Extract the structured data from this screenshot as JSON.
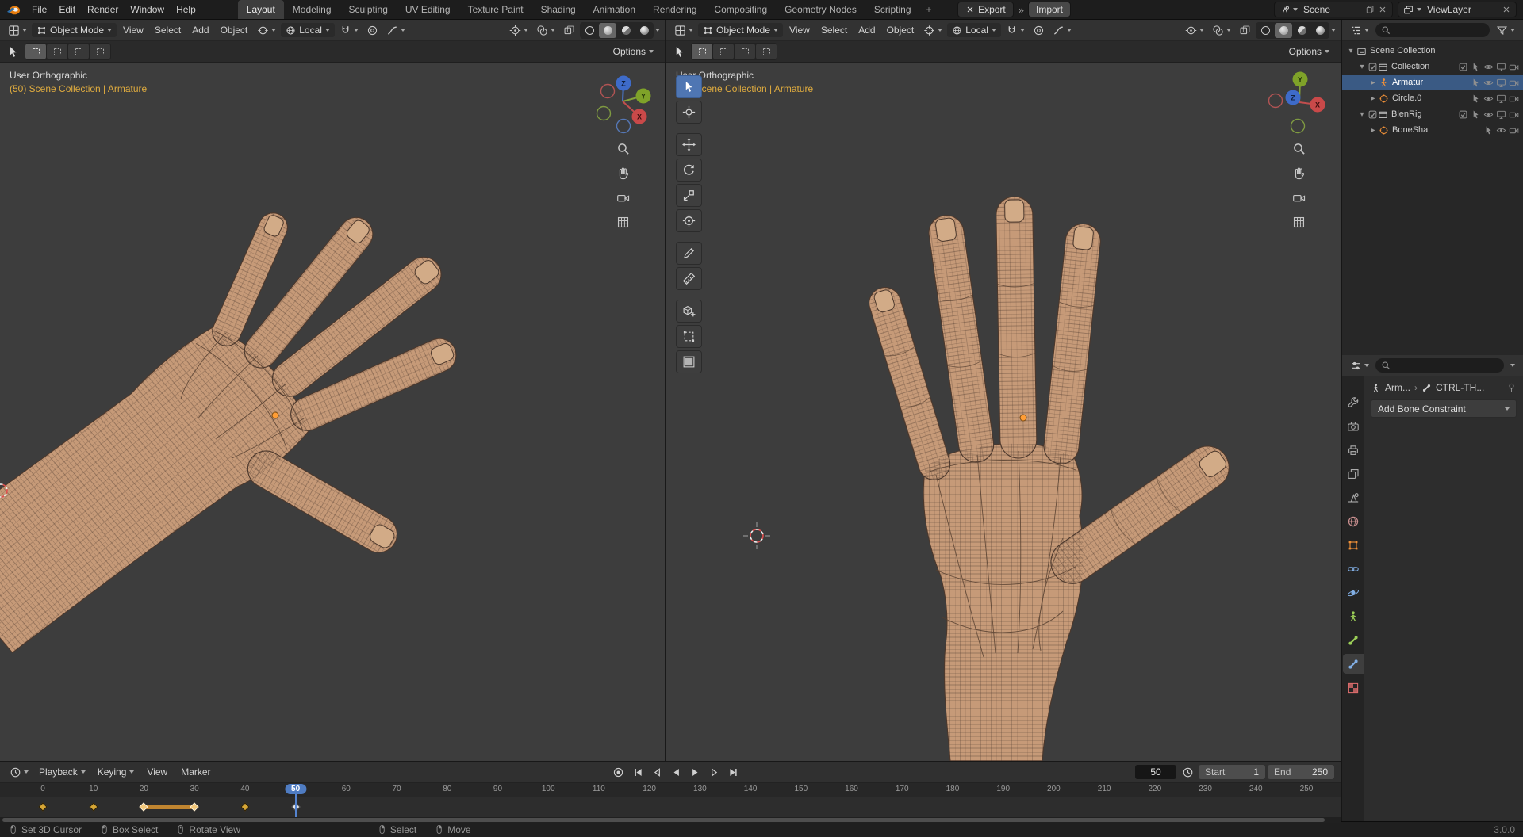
{
  "topbar": {
    "menus": [
      "File",
      "Edit",
      "Render",
      "Window",
      "Help"
    ],
    "workspaces": [
      "Layout",
      "Modeling",
      "Sculpting",
      "UV Editing",
      "Texture Paint",
      "Shading",
      "Animation",
      "Rendering",
      "Compositing",
      "Geometry Nodes",
      "Scripting"
    ],
    "active_workspace": "Layout",
    "add_tab_label": "+",
    "export_label": "Export",
    "import_label": "Import",
    "scene_name": "Scene",
    "viewlayer_name": "ViewLayer"
  },
  "viewport": {
    "mode_label": "Object Mode",
    "menus": [
      "View",
      "Select",
      "Add",
      "Object"
    ],
    "orientation_label": "Local",
    "options_label": "Options",
    "view_name": "User Orthographic",
    "context_line": "(50) Scene Collection | Armature",
    "gizmo_axes": [
      "X",
      "Y",
      "Z"
    ],
    "header_toggles": [
      "gizmos",
      "overlays",
      "xray"
    ],
    "shading_modes": [
      "wireframe",
      "solid",
      "material",
      "rendered"
    ],
    "active_shading": "solid"
  },
  "toolbar": {
    "tools": [
      {
        "icon": "select-box",
        "active": true
      },
      {
        "icon": "cursor",
        "gap": true
      },
      {
        "icon": "move"
      },
      {
        "icon": "rotate"
      },
      {
        "icon": "scale"
      },
      {
        "icon": "transform",
        "gap": true
      },
      {
        "icon": "annotate"
      },
      {
        "icon": "measure",
        "gap": true
      },
      {
        "icon": "add-cube"
      },
      {
        "icon": "scale-cage"
      },
      {
        "icon": "mesh-tool"
      }
    ]
  },
  "outliner": {
    "rows": [
      {
        "label": "Scene Collection",
        "icon": "scene-collection",
        "icon_color": "#c9c9c9",
        "indent": 0,
        "expand": "open",
        "controls": []
      },
      {
        "label": "Collection",
        "icon": "collection",
        "icon_color": "#c9c9c9",
        "indent": 1,
        "expand": "open",
        "checkbox": true,
        "controls": [
          "checkbox",
          "pointer",
          "eye",
          "monitor",
          "camera"
        ]
      },
      {
        "label": "Armatur",
        "icon": "armature",
        "icon_color": "#ef9038",
        "indent": 2,
        "expand": "closed",
        "selected": true,
        "controls": [
          "pointer",
          "eye",
          "monitor",
          "camera"
        ]
      },
      {
        "label": "Circle.0",
        "icon": "mesh-circle",
        "icon_color": "#ef9038",
        "indent": 2,
        "expand": "closed",
        "controls": [
          "pointer",
          "eye",
          "monitor",
          "camera"
        ]
      },
      {
        "label": "BlenRig",
        "icon": "collection",
        "icon_color": "#c9c9c9",
        "indent": 1,
        "expand": "open",
        "checkbox": true,
        "controls": [
          "checkbox",
          "pointer",
          "eye",
          "monitor",
          "camera"
        ]
      },
      {
        "label": "BoneSha",
        "icon": "mesh-circle",
        "icon_color": "#ef9038",
        "indent": 2,
        "expand": "closed",
        "controls": [
          "pointer",
          "eye",
          "camera"
        ]
      }
    ]
  },
  "properties": {
    "tabs": [
      {
        "icon": "tool",
        "color": "#ababab"
      },
      {
        "icon": "render",
        "color": "#ababab"
      },
      {
        "icon": "output",
        "color": "#ababab"
      },
      {
        "icon": "viewlayer",
        "color": "#ababab"
      },
      {
        "icon": "scene",
        "color": "#ababab"
      },
      {
        "icon": "world",
        "color": "#c98f8f"
      },
      {
        "icon": "object",
        "color": "#ef9038"
      },
      {
        "icon": "constraint",
        "color": "#81aee4"
      },
      {
        "icon": "physics",
        "color": "#81aee4"
      },
      {
        "icon": "armature-data",
        "color": "#9bce57"
      },
      {
        "icon": "bone",
        "color": "#9bce57"
      },
      {
        "icon": "bone-constraint",
        "color": "#81aee4",
        "active": true
      },
      {
        "icon": "texture",
        "color": "#d96c6c"
      }
    ],
    "breadcrumb_object": "Arm...",
    "breadcrumb_bone": "CTRL-TH...",
    "add_constraint_label": "Add Bone Constraint"
  },
  "timeline": {
    "menus": {
      "playback": "Playback",
      "keying": "Keying",
      "view": "View",
      "marker": "Marker"
    },
    "frame_start": 0,
    "frame_end": 250,
    "tick_step": 10,
    "playhead": 50,
    "current_frame": "50",
    "start_label": "Start",
    "start_value": "1",
    "end_label": "End",
    "end_value": "250",
    "keys": [
      {
        "frame": 0,
        "type": "normal"
      },
      {
        "frame": 10,
        "type": "normal"
      },
      {
        "frame": 20,
        "type": "selected"
      },
      {
        "frame": 30,
        "type": "selected"
      },
      {
        "frame": 40,
        "type": "normal"
      },
      {
        "frame": 50,
        "type": "light"
      }
    ],
    "key_bar": {
      "from": 20,
      "to": 30
    }
  },
  "statusbar": {
    "hints": [
      {
        "icon": "mouse-left",
        "label": "Set 3D Cursor"
      },
      {
        "icon": "mouse-left",
        "label": "Box Select"
      },
      {
        "icon": "mouse-middle",
        "label": "Rotate View"
      },
      {
        "icon": "mouse-right",
        "label": "Select",
        "gap": true
      },
      {
        "icon": "mouse-right",
        "label": "Move"
      }
    ],
    "version": "3.0.0"
  }
}
